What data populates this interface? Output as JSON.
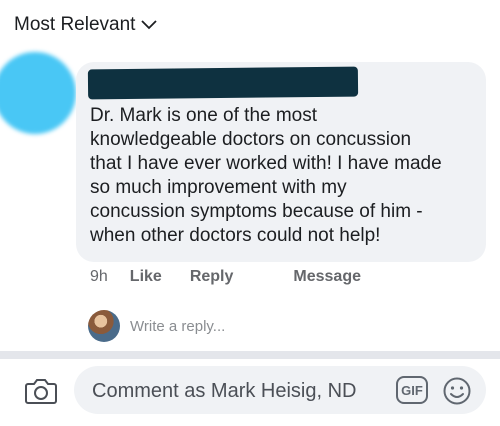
{
  "sort": {
    "label": "Most Relevant",
    "chevron_icon": "chevron-down-icon"
  },
  "comment": {
    "author_redacted": true,
    "text": "Dr. Mark is one of the most\nknowledgeable doctors on concussion\nthat I have ever worked with!  I have made\nso much improvement with my\nconcussion symptoms because of him -\nwhen other doctors could not help!",
    "time": "9h",
    "like_label": "Like",
    "reply_label": "Reply",
    "message_label": "Message"
  },
  "reply_box": {
    "placeholder": "Write a reply..."
  },
  "composer": {
    "placeholder": "Comment as Mark Heisig, ND",
    "gif_label": "GIF",
    "camera_icon": "camera-icon",
    "emoji_icon": "emoji-icon"
  },
  "colors": {
    "bubble": "#f0f2f5",
    "redaction": "#0e3140",
    "avatar_blur": "#49c7f5",
    "secondary_text": "#65676b"
  }
}
